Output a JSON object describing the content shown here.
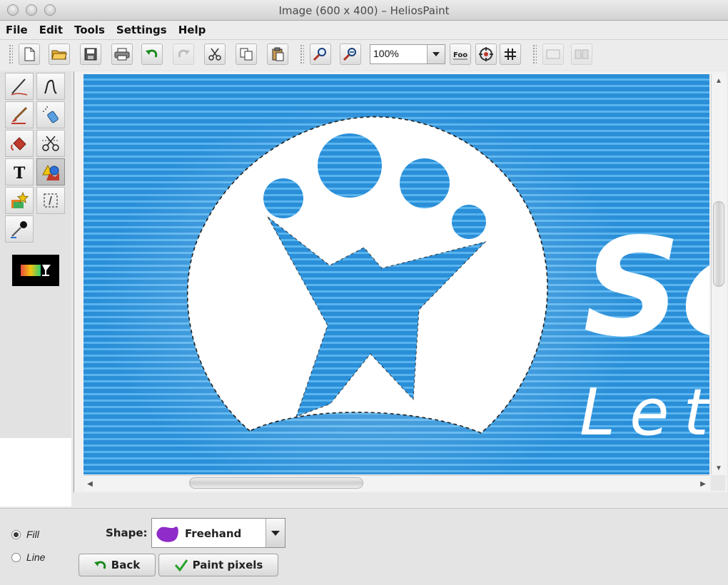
{
  "window": {
    "title": "Image (600 x 400) – HeliosPaint"
  },
  "menu": [
    "File",
    "Edit",
    "Tools",
    "Settings",
    "Help"
  ],
  "toolbar": {
    "zoom_value": "100%",
    "icons": [
      "new-file-icon",
      "open-folder-icon",
      "save-icon",
      "print-icon",
      "undo-icon",
      "redo-icon",
      "cut-icon",
      "copy-icon",
      "paste-icon",
      "zoom-in-icon",
      "zoom-out-icon",
      "text-size-icon",
      "center-icon",
      "grid-icon",
      "layout-single-icon",
      "layout-split-icon"
    ]
  },
  "tools": [
    "pencil-icon",
    "curve-icon",
    "brush-icon",
    "spray-icon",
    "fill-bucket-icon",
    "scissors-icon",
    "text-tool-icon",
    "shapes-tool-icon",
    "stamp-icon",
    "select-rect-icon",
    "color-picker-icon"
  ],
  "canvas": {
    "background_color": "#2a8fd8",
    "overlay_text_1": "Sc",
    "overlay_text_2": "Let"
  },
  "bottom_panel": {
    "fill_label": "Fill",
    "line_label": "Line",
    "shape_label": "Shape:",
    "shape_value": "Freehand",
    "back_label": "Back",
    "paint_label": "Paint pixels"
  }
}
